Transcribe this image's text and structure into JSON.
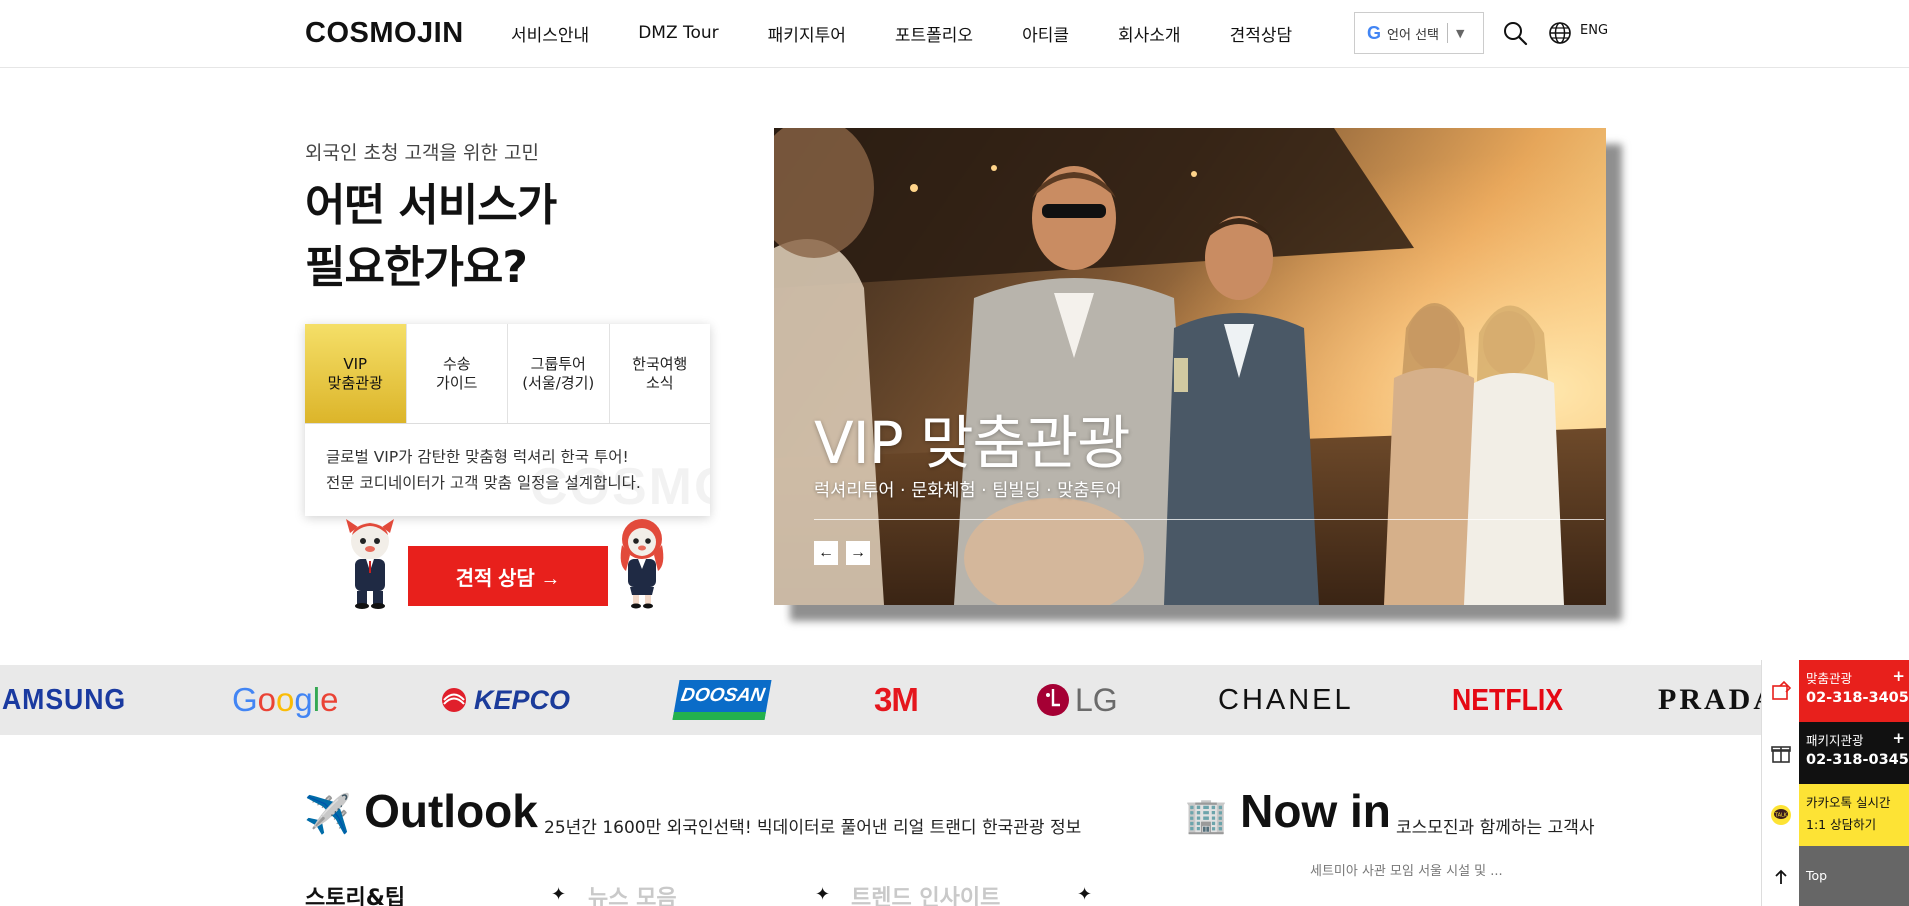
{
  "header": {
    "logo": "COSMOJIN",
    "nav": [
      "서비스안내",
      "DMZ Tour",
      "패키지투어",
      "포트폴리오",
      "아티클",
      "회사소개",
      "견적상담"
    ],
    "language_select": "언어 선택",
    "lang_toggle": "ENG"
  },
  "hero": {
    "eyebrow": "외국인 초청 고객을 위한 고민",
    "title_line1": "어떤 서비스가",
    "title_line2": "필요한가요?",
    "tabs": [
      {
        "label": "VIP\n맞춤관광",
        "active": true
      },
      {
        "label": "수송\n가이드",
        "active": false
      },
      {
        "label": "그룹투어\n(서울/경기)",
        "active": false
      },
      {
        "label": "한국여행\n소식",
        "active": false
      }
    ],
    "desc_line1": "글로벌 VIP가 감탄한 맞춤형 럭셔리 한국 투어!",
    "desc_line2": "전문 코디네이터가 고객 맞춤 일정을 설계합니다.",
    "card_watermark": "COSMO",
    "cta": "견적 상담 →"
  },
  "slide": {
    "title": "VIP 맞춤관광",
    "subtitle": "럭셔리투어 · 문화체험 · 팀빌딩 · 맞춤투어",
    "prev": "←",
    "next": "→"
  },
  "clients": [
    "AMSUNG",
    "Google",
    "KEPCO",
    "DOOSAN",
    "3M",
    "LG",
    "CHANEL",
    "NETFLIX",
    "PRADA"
  ],
  "outlook": {
    "icon": "✈️",
    "title": "Outlook",
    "desc": "25년간 1600만 외국인선택! 빅데이터로 풀어낸 리얼 트랜디 한국관광 정보",
    "tabs": [
      "스토리&팁",
      "뉴스 모음",
      "트렌드 인사이트"
    ]
  },
  "nowin": {
    "icon": "🏢",
    "title": "Now in",
    "desc": "코스모진과 함께하는 고객사",
    "preview": "세트미아 사관 모임 서울 시설 및 ..."
  },
  "quick_menu": [
    {
      "label": "맞춤관광",
      "phone": "02-318-3405",
      "bg": "#e8201c",
      "color": "#ffffff",
      "icon": "customized-tour-icon"
    },
    {
      "label": "패키지관광",
      "phone": "02-318-0345",
      "bg": "#111111",
      "color": "#ffffff",
      "icon": "package-gift-icon"
    },
    {
      "label": "카카오톡 실시간",
      "phone": "1:1 상담하기",
      "bg": "#fde335",
      "color": "#111111",
      "icon": "kakaotalk-icon"
    },
    {
      "label": "Top",
      "phone": "",
      "bg": "#666666",
      "color": "#ffffff",
      "icon": "arrow-up-icon"
    }
  ],
  "colors": {
    "brand_red": "#e8201c",
    "gold": "#dcb52a",
    "strip_bg": "#e9e9e9"
  }
}
